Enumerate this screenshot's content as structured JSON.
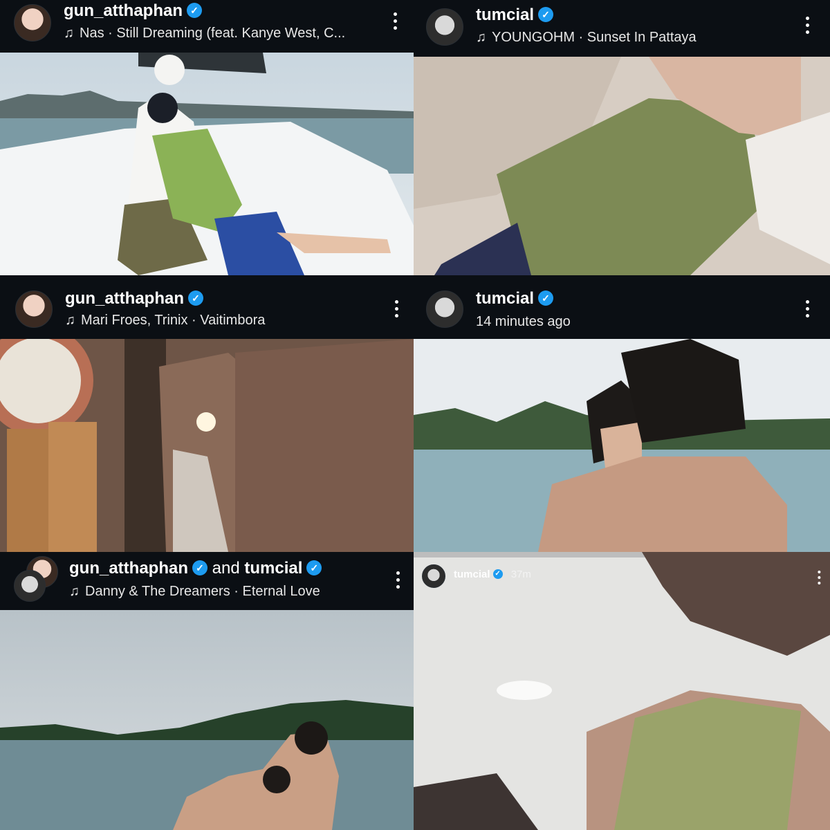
{
  "stories": [
    {
      "username": "gun_atthaphan",
      "subtitle": "Nas · Still Dreaming (feat. Kanye West, C...",
      "subtitle_kind": "music"
    },
    {
      "username": "tumcial",
      "subtitle": "YOUNGOHM · Sunset In Pattaya",
      "subtitle_kind": "music"
    },
    {
      "username": "gun_atthaphan",
      "subtitle": "Mari Froes, Trinix · Vaitimbora",
      "subtitle_kind": "music"
    },
    {
      "username": "tumcial",
      "subtitle": "14 minutes ago",
      "subtitle_kind": "time"
    },
    {
      "username": "gun_atthaphan",
      "conjunction": "and",
      "username2": "tumcial",
      "subtitle": "Danny & The Dreamers · Eternal Love",
      "subtitle_kind": "music"
    },
    {
      "username": "tumcial",
      "time": "37m"
    }
  ],
  "icons": {
    "verified": "verified-badge-icon",
    "music": "music-note-icon",
    "more": "more-options-icon"
  },
  "colors": {
    "header_bg": "#0b0f14",
    "verified": "#1d9bf0",
    "text": "#ffffff"
  }
}
